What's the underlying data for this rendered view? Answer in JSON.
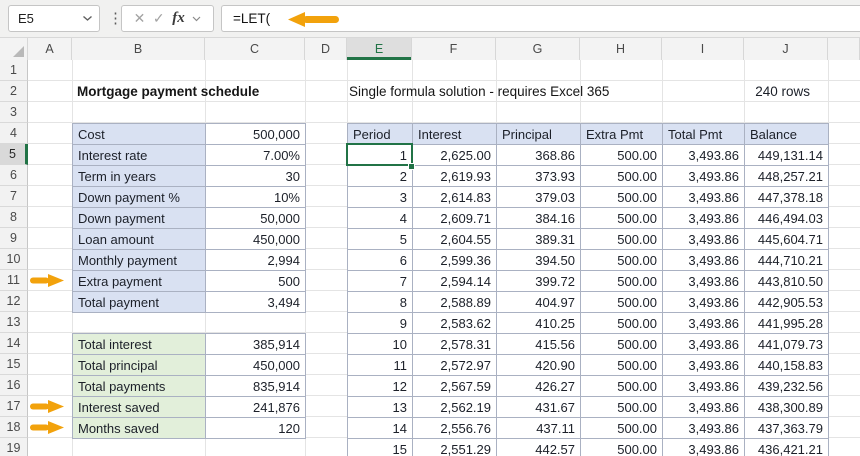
{
  "formula_bar": {
    "cell_ref": "E5",
    "formula": "=LET("
  },
  "icons": {
    "more": "⋮",
    "cancel": "✕",
    "enter": "✓",
    "fx_label": "fx"
  },
  "grid": {
    "column_labels": [
      "A",
      "B",
      "C",
      "D",
      "E",
      "F",
      "G",
      "H",
      "I",
      "J"
    ],
    "selected_column": "E",
    "row_count": 19,
    "selected_row": 5,
    "selected_cell": "E5"
  },
  "titles": {
    "main": "Mortgage payment schedule",
    "subtitle": "Single formula solution - requires Excel 365",
    "rows_note": "240 rows"
  },
  "inputs_table": {
    "rows": [
      {
        "label": "Cost",
        "value": "500,000"
      },
      {
        "label": "Interest rate",
        "value": "7.00%"
      },
      {
        "label": "Term in years",
        "value": "30"
      },
      {
        "label": "Down payment %",
        "value": "10%"
      },
      {
        "label": "Down payment",
        "value": "50,000"
      },
      {
        "label": "Loan amount",
        "value": "450,000"
      },
      {
        "label": "Monthly payment",
        "value": "2,994"
      },
      {
        "label": "Extra payment",
        "value": "500"
      },
      {
        "label": "Total payment",
        "value": "3,494"
      }
    ]
  },
  "summary_table": {
    "rows": [
      {
        "label": "Total interest",
        "value": "385,914"
      },
      {
        "label": "Total principal",
        "value": "450,000"
      },
      {
        "label": "Total payments",
        "value": "835,914"
      },
      {
        "label": "Interest saved",
        "value": "241,876"
      },
      {
        "label": "Months saved",
        "value": "120"
      }
    ]
  },
  "schedule_table": {
    "headers": [
      "Period",
      "Interest",
      "Principal",
      "Extra Pmt",
      "Total Pmt",
      "Balance"
    ],
    "rows": [
      [
        "1",
        "2,625.00",
        "368.86",
        "500.00",
        "3,493.86",
        "449,131.14"
      ],
      [
        "2",
        "2,619.93",
        "373.93",
        "500.00",
        "3,493.86",
        "448,257.21"
      ],
      [
        "3",
        "2,614.83",
        "379.03",
        "500.00",
        "3,493.86",
        "447,378.18"
      ],
      [
        "4",
        "2,609.71",
        "384.16",
        "500.00",
        "3,493.86",
        "446,494.03"
      ],
      [
        "5",
        "2,604.55",
        "389.31",
        "500.00",
        "3,493.86",
        "445,604.71"
      ],
      [
        "6",
        "2,599.36",
        "394.50",
        "500.00",
        "3,493.86",
        "444,710.21"
      ],
      [
        "7",
        "2,594.14",
        "399.72",
        "500.00",
        "3,493.86",
        "443,810.50"
      ],
      [
        "8",
        "2,588.89",
        "404.97",
        "500.00",
        "3,493.86",
        "442,905.53"
      ],
      [
        "9",
        "2,583.62",
        "410.25",
        "500.00",
        "3,493.86",
        "441,995.28"
      ],
      [
        "10",
        "2,578.31",
        "415.56",
        "500.00",
        "3,493.86",
        "441,079.73"
      ],
      [
        "11",
        "2,572.97",
        "420.90",
        "500.00",
        "3,493.86",
        "440,158.83"
      ],
      [
        "12",
        "2,567.59",
        "426.27",
        "500.00",
        "3,493.86",
        "439,232.56"
      ],
      [
        "13",
        "2,562.19",
        "431.67",
        "500.00",
        "3,493.86",
        "438,300.89"
      ],
      [
        "14",
        "2,556.76",
        "437.11",
        "500.00",
        "3,493.86",
        "437,363.79"
      ],
      [
        "15",
        "2,551.29",
        "442.57",
        "500.00",
        "3,493.86",
        "436,421.21"
      ]
    ]
  },
  "colors": {
    "selection_green": "#217346",
    "arrow_orange": "#f2a20c",
    "input_label_fill": "#d9e1f2",
    "summary_label_fill": "#e2efda"
  }
}
